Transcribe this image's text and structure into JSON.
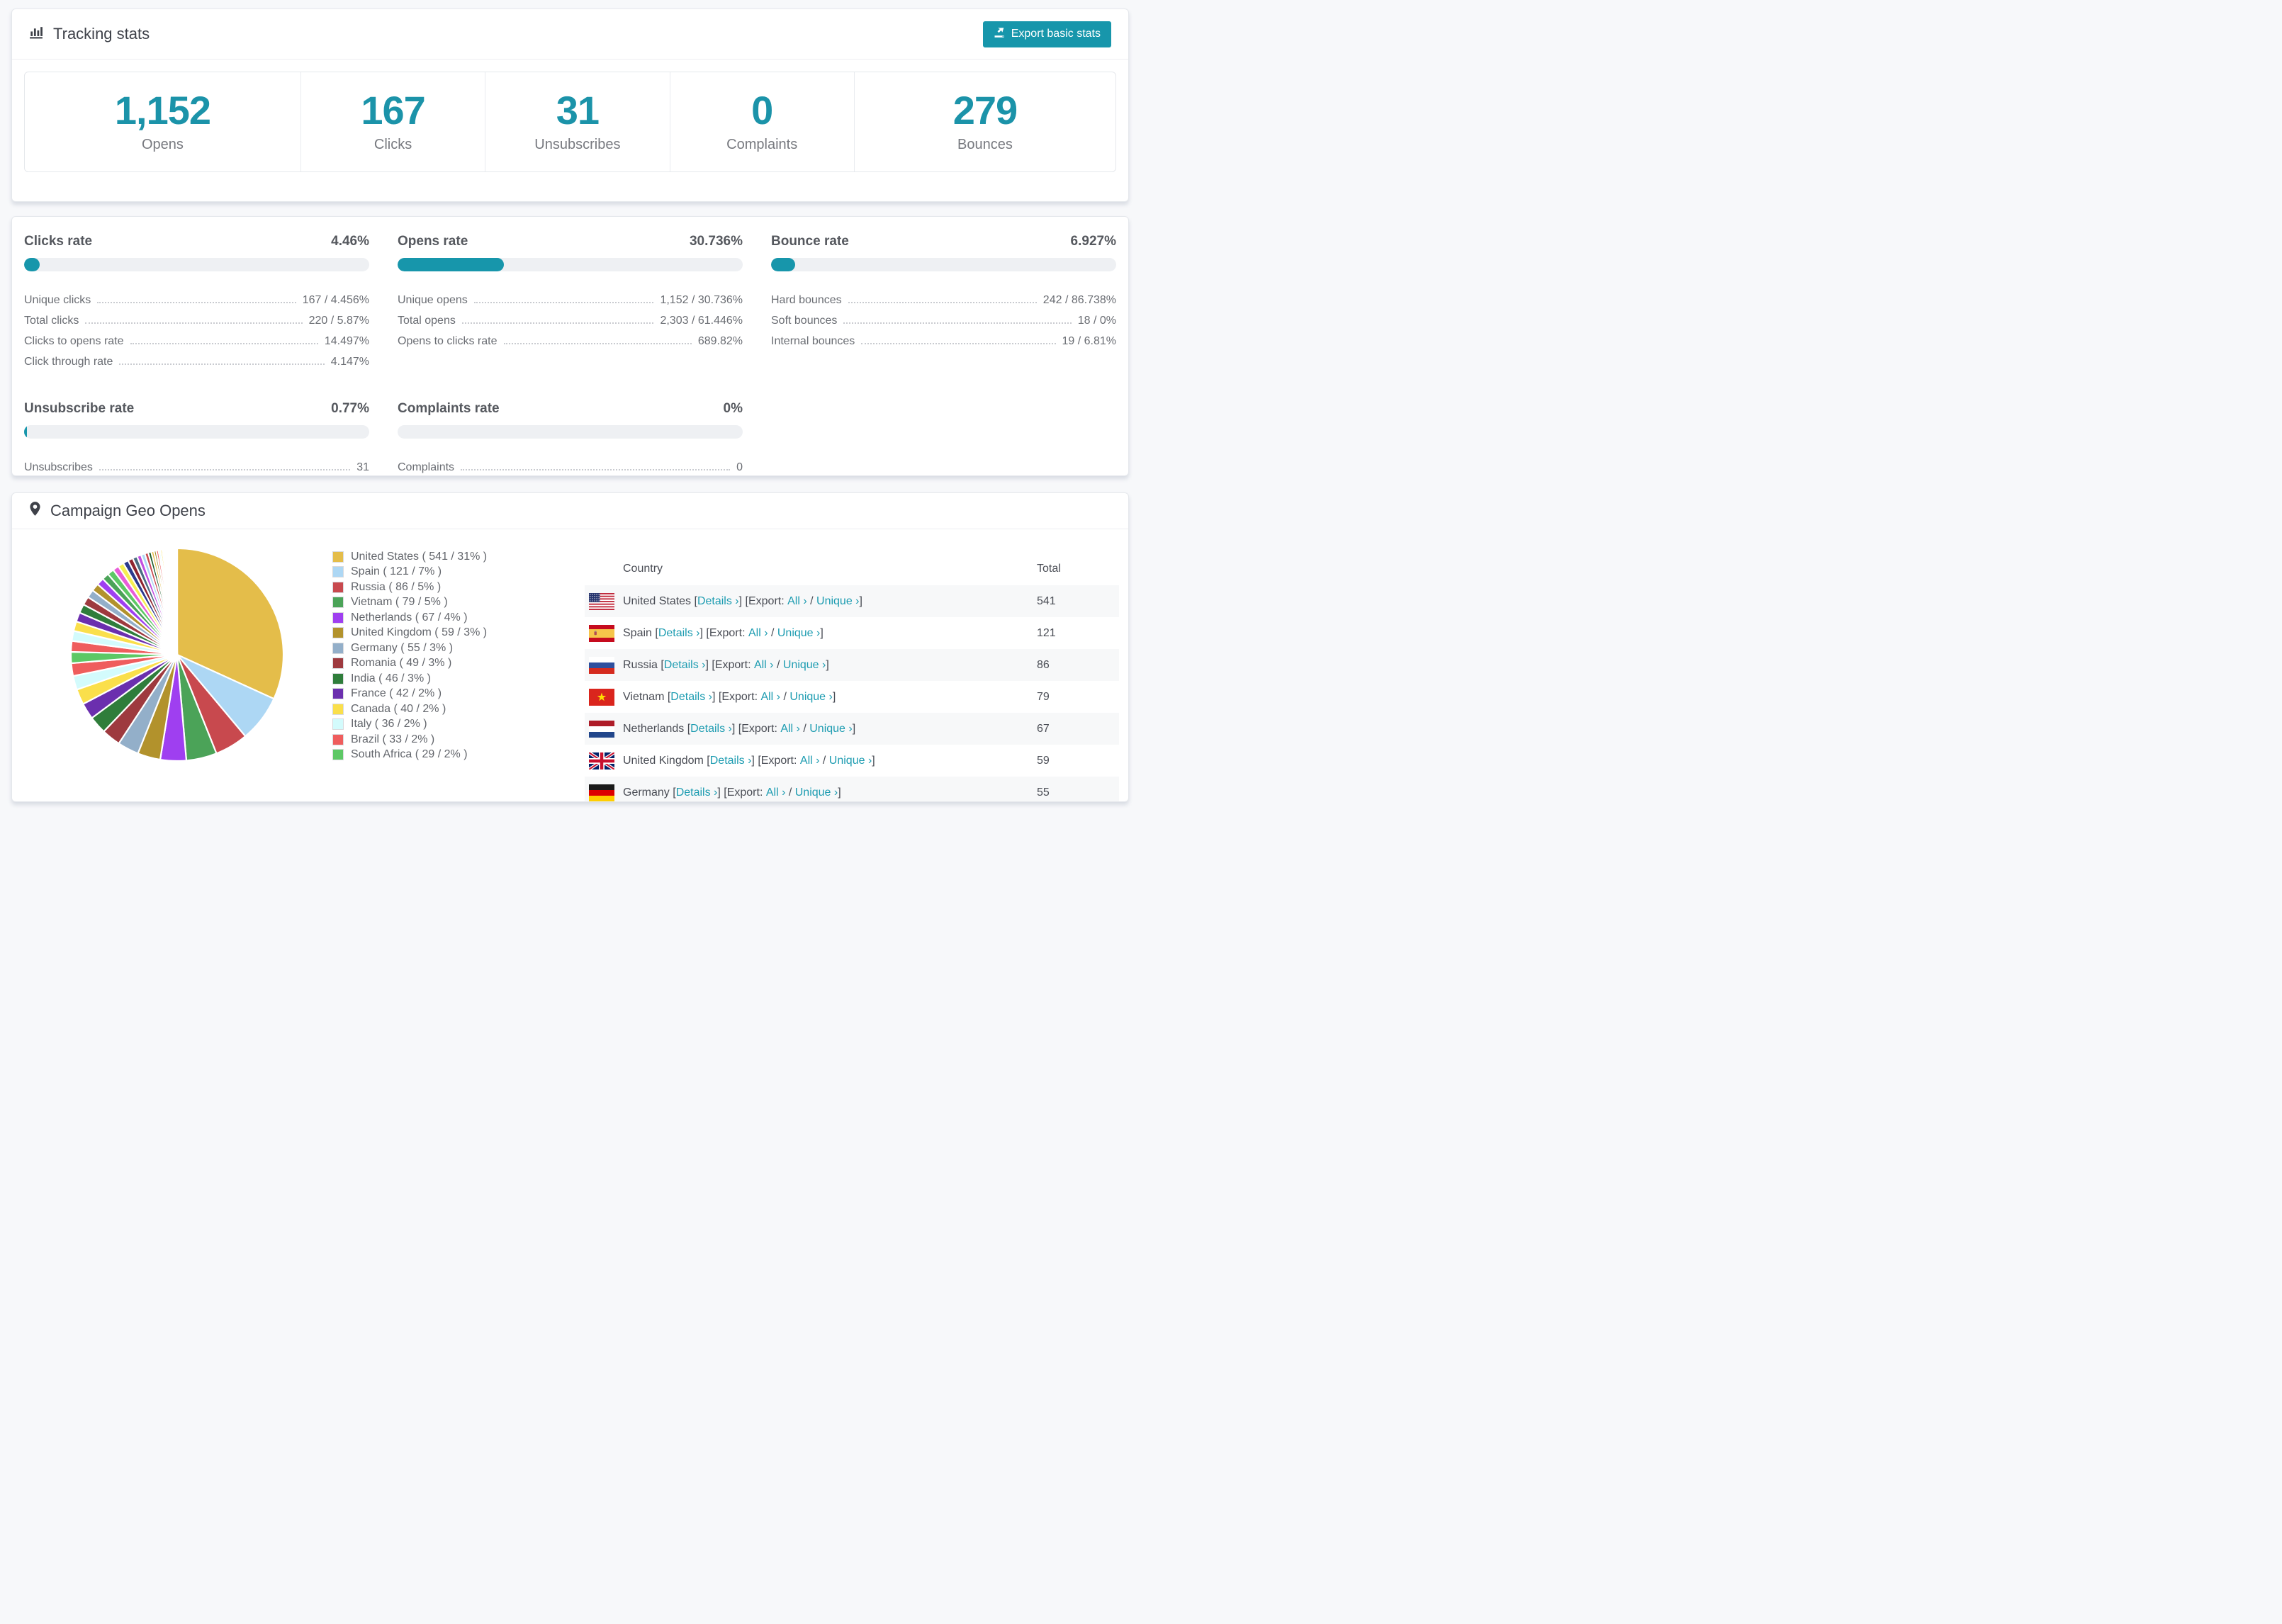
{
  "accent_color": "#1796ab",
  "tracking": {
    "title": "Tracking stats",
    "export_button": "Export basic stats",
    "stats": [
      {
        "value": "1,152",
        "label": "Opens"
      },
      {
        "value": "167",
        "label": "Clicks"
      },
      {
        "value": "31",
        "label": "Unsubscribes"
      },
      {
        "value": "0",
        "label": "Complaints"
      },
      {
        "value": "279",
        "label": "Bounces"
      }
    ]
  },
  "rates": [
    {
      "title": "Clicks rate",
      "value": "4.46%",
      "percent": 4.46,
      "rows": [
        {
          "label": "Unique clicks",
          "value": "167 / 4.456%"
        },
        {
          "label": "Total clicks",
          "value": "220 / 5.87%"
        },
        {
          "label": "Clicks to opens rate",
          "value": "14.497%"
        },
        {
          "label": "Click through rate",
          "value": "4.147%"
        }
      ]
    },
    {
      "title": "Opens rate",
      "value": "30.736%",
      "percent": 30.736,
      "rows": [
        {
          "label": "Unique opens",
          "value": "1,152 / 30.736%"
        },
        {
          "label": "Total opens",
          "value": "2,303 / 61.446%"
        },
        {
          "label": "Opens to clicks rate",
          "value": "689.82%"
        }
      ]
    },
    {
      "title": "Bounce rate",
      "value": "6.927%",
      "percent": 6.927,
      "rows": [
        {
          "label": "Hard bounces",
          "value": "242 / 86.738%"
        },
        {
          "label": "Soft bounces",
          "value": "18 / 0%"
        },
        {
          "label": "Internal bounces",
          "value": "19 / 6.81%"
        }
      ]
    },
    {
      "title": "Unsubscribe rate",
      "value": "0.77%",
      "percent": 0.77,
      "rows": [
        {
          "label": "Unsubscribes",
          "value": "31"
        }
      ]
    },
    {
      "title": "Complaints rate",
      "value": "0%",
      "percent": 0,
      "rows": [
        {
          "label": "Complaints",
          "value": "0"
        }
      ]
    }
  ],
  "geo": {
    "title": "Campaign Geo Opens",
    "table": {
      "headers": [
        "Country",
        "Total"
      ],
      "details_label": "Details ›",
      "export_prefix": "[Export: ",
      "all_label": "All ›",
      "unique_label": "Unique ›",
      "rows": [
        {
          "country": "United States",
          "flag": "us",
          "total": "541"
        },
        {
          "country": "Spain",
          "flag": "es",
          "total": "121"
        },
        {
          "country": "Russia",
          "flag": "ru",
          "total": "86"
        },
        {
          "country": "Vietnam",
          "flag": "vn",
          "total": "79"
        },
        {
          "country": "Netherlands",
          "flag": "nl",
          "total": "67"
        },
        {
          "country": "United Kingdom",
          "flag": "gb",
          "total": "59"
        },
        {
          "country": "Germany",
          "flag": "de",
          "total": "55"
        }
      ]
    }
  },
  "chart_data": {
    "type": "pie",
    "title": "Campaign Geo Opens",
    "legend_position": "right",
    "start_angle_deg": 0,
    "direction": "clockwise",
    "legend_format": "{name} ( {value} / {pct}% )",
    "series": [
      {
        "name": "United States",
        "value": 541,
        "pct": 31,
        "color": "#e4bd4a"
      },
      {
        "name": "Spain",
        "value": 121,
        "pct": 7,
        "color": "#add7f4"
      },
      {
        "name": "Russia",
        "value": 86,
        "pct": 5,
        "color": "#c8494e"
      },
      {
        "name": "Vietnam",
        "value": 79,
        "pct": 5,
        "color": "#4ba358"
      },
      {
        "name": "Netherlands",
        "value": 67,
        "pct": 4,
        "color": "#9f3ff0"
      },
      {
        "name": "United Kingdom",
        "value": 59,
        "pct": 3,
        "color": "#b2922c"
      },
      {
        "name": "Germany",
        "value": 55,
        "pct": 3,
        "color": "#93afc9"
      },
      {
        "name": "Romania",
        "value": 49,
        "pct": 3,
        "color": "#9e3a3f"
      },
      {
        "name": "India",
        "value": 46,
        "pct": 3,
        "color": "#2f7d3b"
      },
      {
        "name": "France",
        "value": 42,
        "pct": 2,
        "color": "#6b2fae"
      },
      {
        "name": "Canada",
        "value": 40,
        "pct": 2,
        "color": "#fadf4b"
      },
      {
        "name": "Italy",
        "value": 36,
        "pct": 2,
        "color": "#d3fbfc"
      },
      {
        "name": "Brazil",
        "value": 33,
        "pct": 2,
        "color": "#ef5d5d"
      },
      {
        "name": "South Africa",
        "value": 29,
        "pct": 2,
        "color": "#5dc865"
      }
    ],
    "other_slices": {
      "description": "long tail of smaller unlabeled countries",
      "values": [
        28,
        26,
        25,
        24,
        23,
        22,
        21,
        20,
        19,
        18,
        17,
        16,
        15,
        14,
        13,
        12,
        11,
        10,
        9,
        8,
        7,
        6,
        6,
        5,
        5,
        4,
        4,
        3,
        3,
        3,
        2,
        2,
        2,
        2,
        2,
        1,
        1,
        1,
        1,
        1,
        1,
        1,
        1,
        1,
        1,
        1
      ],
      "palette": [
        "#ef5d5d",
        "#d3fbfc",
        "#fadf4b",
        "#6b2fae",
        "#2f7d3b",
        "#9e3a3f",
        "#93afc9",
        "#b2922c",
        "#9f3ff0",
        "#4ba358",
        "#5dc865",
        "#e85dd8",
        "#f5ef51",
        "#2b3a8c",
        "#8f2430",
        "#4a6b82",
        "#c24fe0",
        "#add7f4",
        "#c8494e",
        "#1c5c2c",
        "#e4bd4a",
        "#9a7d1e"
      ]
    }
  }
}
